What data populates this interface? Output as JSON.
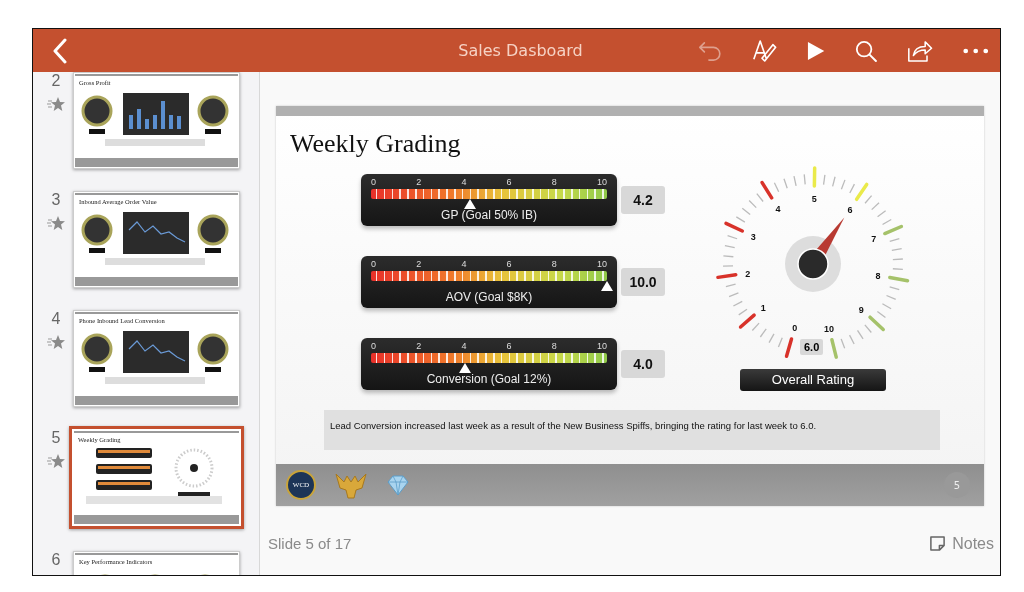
{
  "app_bar": {
    "title": "Sales Dasboard",
    "tools": [
      {
        "kind": "undo",
        "disabled": true
      },
      {
        "kind": "edit-text",
        "disabled": false
      },
      {
        "kind": "play",
        "disabled": false
      },
      {
        "kind": "search",
        "disabled": false
      },
      {
        "kind": "share",
        "disabled": false
      },
      {
        "kind": "more",
        "disabled": false
      }
    ]
  },
  "thumbnails": [
    {
      "number": "2",
      "title": "Gross Profit",
      "kind": "bar",
      "selected": false
    },
    {
      "number": "3",
      "title": "Inbound Average Order Value",
      "kind": "line",
      "selected": false
    },
    {
      "number": "4",
      "title": "Phone Inbound Lead Conversion",
      "kind": "line",
      "selected": false
    },
    {
      "number": "5",
      "title": "Weekly Grading",
      "kind": "grading",
      "selected": true
    },
    {
      "number": "6",
      "title": "Key Performance Indicators",
      "kind": "kpi",
      "selected": false
    }
  ],
  "slide": {
    "title": "Weekly Grading",
    "meters": [
      {
        "scale": [
          "0",
          "2",
          "4",
          "6",
          "8",
          "10"
        ],
        "label": "GP (Goal 50% IB)",
        "level": 0.42,
        "reading": "4.2"
      },
      {
        "scale": [
          "0",
          "2",
          "4",
          "6",
          "8",
          "10"
        ],
        "label": "AOV (Goal $8K)",
        "level": 1.0,
        "reading": "10.0"
      },
      {
        "scale": [
          "0",
          "2",
          "4",
          "6",
          "8",
          "10"
        ],
        "label": "Conversion (Goal 12%)",
        "level": 0.4,
        "reading": "4.0"
      }
    ],
    "dial": {
      "labels": [
        "0",
        "1",
        "2",
        "3",
        "4",
        "5",
        "6",
        "7",
        "8",
        "9",
        "10"
      ],
      "level": 0.6,
      "reading": "6.0",
      "caption": "Overall Rating"
    },
    "comment": "Lead Conversion increased last week as a result of the New Business Spiffs, bringing the rating for last week to 6.0.",
    "footer": {
      "logo_text": "WCD",
      "page_number": "5"
    }
  },
  "status": {
    "position": "Slide 5 of 17",
    "notes": "Notes"
  }
}
